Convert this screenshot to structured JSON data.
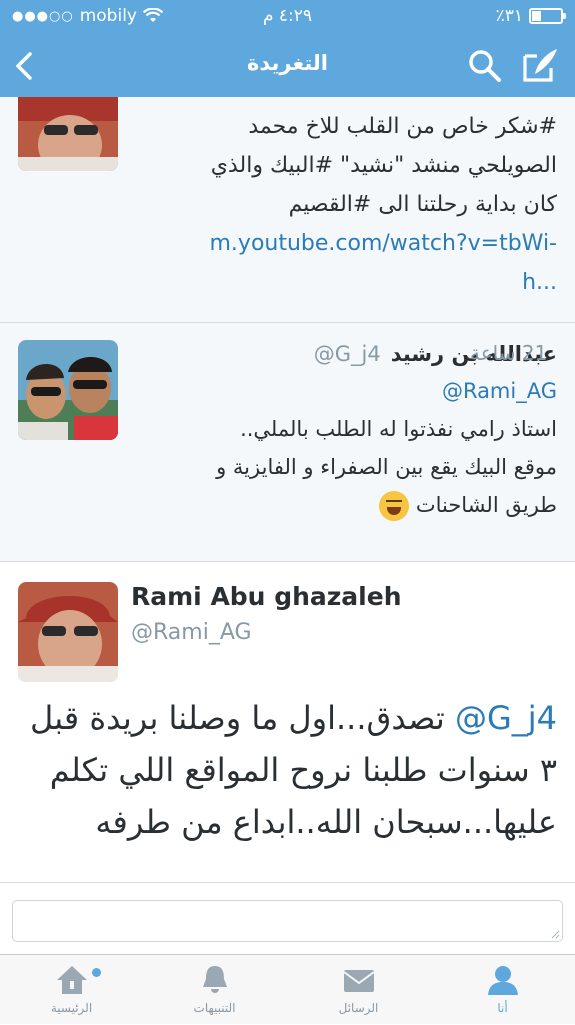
{
  "status": {
    "carrier": "mobily",
    "time": "٤:٢٩ م",
    "battery_percent": "٪٣١",
    "battery_level": 0.31
  },
  "nav": {
    "title": "التغريدة",
    "back_icon": "chevron-left-icon",
    "search_icon": "search-icon",
    "compose_icon": "compose-icon"
  },
  "tweets": {
    "prev": {
      "lines": [
        "#شكر خاص من القلب للاخ محمد",
        "الصويلحي منشد \"نشيد\" #البيك والذي",
        "كان بداية رحلتنا الى #القصيم"
      ],
      "link": [
        "m.youtube.com/watch?v=tbWi-",
        "h..."
      ]
    },
    "reply": {
      "name": "عبدالله بن رشيد",
      "handle": "@G_j4",
      "time": "21 ساعة",
      "mention": "@Rami_AG",
      "lines": [
        "استاذ رامي نفذتوا له الطلب بالملي..",
        "موقع البيك يقع بين الصفراء و الفايزية و",
        "طريق الشاحنات"
      ]
    },
    "main": {
      "name": "Rami Abu ghazaleh",
      "handle": "@Rami_AG",
      "mention": "@G_j4",
      "line1": "تصدق...اول ما وصلنا بريدة قبل",
      "line2": "٣ سنوات طلبنا نروح المواقع اللي تكلم",
      "line3": "عليها...سبحان الله..ابداع من طرفه"
    }
  },
  "reply_box": {
    "value": ""
  },
  "tabs": [
    {
      "label": "الرئيسية",
      "icon": "home-icon"
    },
    {
      "label": "التنبيهات",
      "icon": "bell-icon"
    },
    {
      "label": "الرسائل",
      "icon": "envelope-icon"
    },
    {
      "label": "أنا",
      "icon": "profile-icon"
    }
  ],
  "colors": {
    "brand": "#5fa8de",
    "link": "#2b7bb9",
    "muted": "#8899a6"
  }
}
